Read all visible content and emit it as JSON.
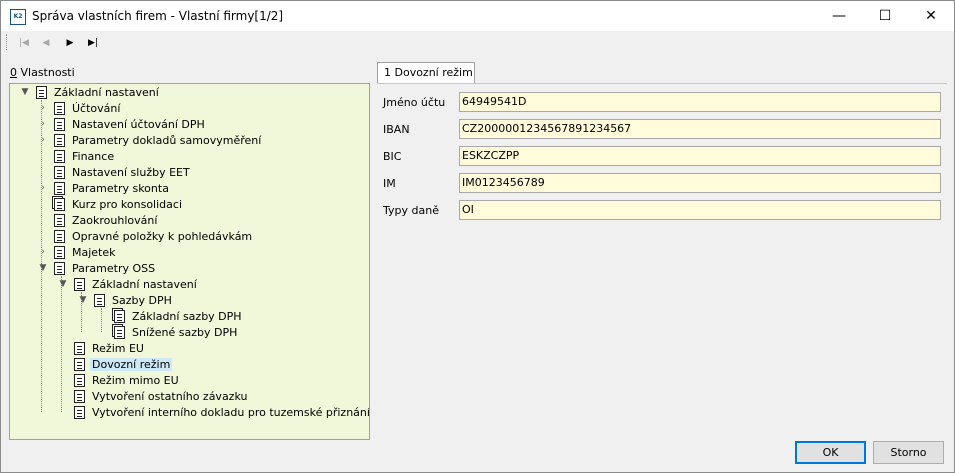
{
  "window": {
    "title": "Správa vlastních firem - Vlastní firmy[1/2]",
    "app_icon_text": "K2",
    "minimize": "—",
    "maximize": "☐",
    "close": "✕"
  },
  "toolbar": {
    "first": "|◀",
    "prev": "◀",
    "next": "▶",
    "last": "▶|"
  },
  "properties_panel": {
    "label_mnemonic": "0",
    "label_rest": " Vlastnosti"
  },
  "tree": [
    "Základní nastavení",
    "Účtování",
    "Nastavení účtování DPH",
    "Parametry dokladů samovyměření",
    "Finance",
    "Nastavení služby EET",
    "Parametry skonta",
    "Kurz pro konsolidaci",
    "Zaokrouhlování",
    "Opravné položky k pohledávkám",
    "Majetek",
    "Parametry OSS",
    "Základní nastavení",
    "Sazby DPH",
    "Základní sazby DPH",
    "Snížené sazby DPH",
    "Režim EU",
    "Dovozní režim",
    "Režim mimo EU",
    "Vytvoření ostatního závazku",
    "Vytvoření interního dokladu pro tuzemské přiznání k DPH"
  ],
  "tab": {
    "label": "1 Dovozní režim"
  },
  "fields": {
    "account_name_label": "Jméno účtu",
    "account_name_value": "64949541D",
    "iban_label": "IBAN",
    "iban_value": "CZ2000001234567891234567",
    "bic_label": "BIC",
    "bic_value": "ESKZCZPP",
    "im_label": "IM",
    "im_value": "IM0123456789",
    "tax_types_label": "Typy daně",
    "tax_types_value": "OI"
  },
  "buttons": {
    "ok": "OK",
    "cancel": "Storno"
  }
}
